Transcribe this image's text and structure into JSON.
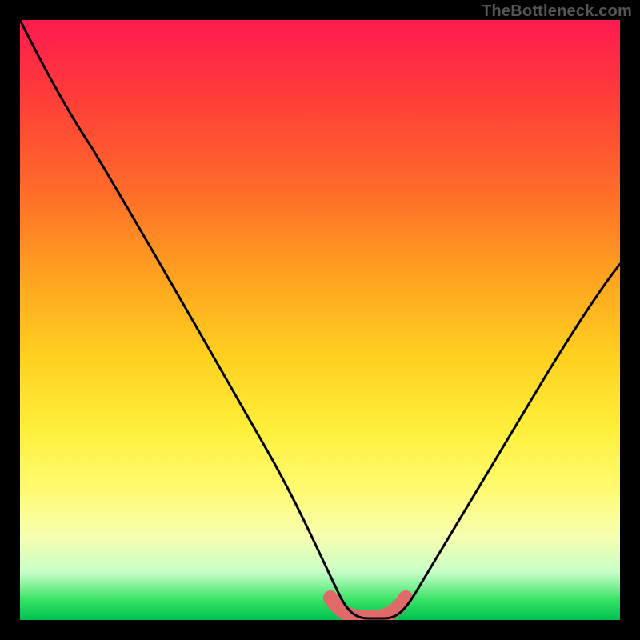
{
  "watermark": "TheBottleneck.com",
  "chart_data": {
    "type": "line",
    "title": "",
    "xlabel": "",
    "ylabel": "",
    "xlim": [
      0,
      100
    ],
    "ylim": [
      0,
      100
    ],
    "series": [
      {
        "name": "bottleneck-curve",
        "x": [
          0,
          8,
          12,
          20,
          30,
          40,
          48,
          52,
          55,
          60,
          66,
          72,
          80,
          90,
          100
        ],
        "values": [
          100,
          86,
          80,
          66,
          48,
          30,
          13,
          4,
          0,
          0,
          4,
          12,
          24,
          40,
          56
        ]
      },
      {
        "name": "highlight-band",
        "x": [
          52,
          55,
          60,
          64
        ],
        "values": [
          3,
          0.5,
          0.5,
          3
        ]
      }
    ],
    "annotations": []
  },
  "colors": {
    "background": "#000000",
    "gradient_top": "#ff1a4f",
    "gradient_bottom": "#00c050",
    "curve": "#000000",
    "highlight": "#e06a6a"
  }
}
